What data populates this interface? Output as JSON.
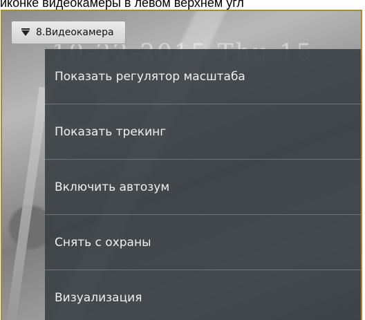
{
  "caption": "иконке видеокамеры в левом верхнем угл",
  "video": {
    "osd_timestamp": "10-22-2015 Thu 15"
  },
  "camera_header": {
    "title": "8.Видеокамера",
    "icon": "filter-icon"
  },
  "context_menu": {
    "items": [
      {
        "label": "Показать регулятор масштаба"
      },
      {
        "label": "Показать трекинг"
      },
      {
        "label": "Включить автозум"
      },
      {
        "label": "Снять с охраны"
      },
      {
        "label": "Визуализация"
      }
    ]
  },
  "colors": {
    "frame_border": "#b5842d",
    "menu_background": "#3a3f45",
    "menu_text": "#f0f0f0"
  }
}
